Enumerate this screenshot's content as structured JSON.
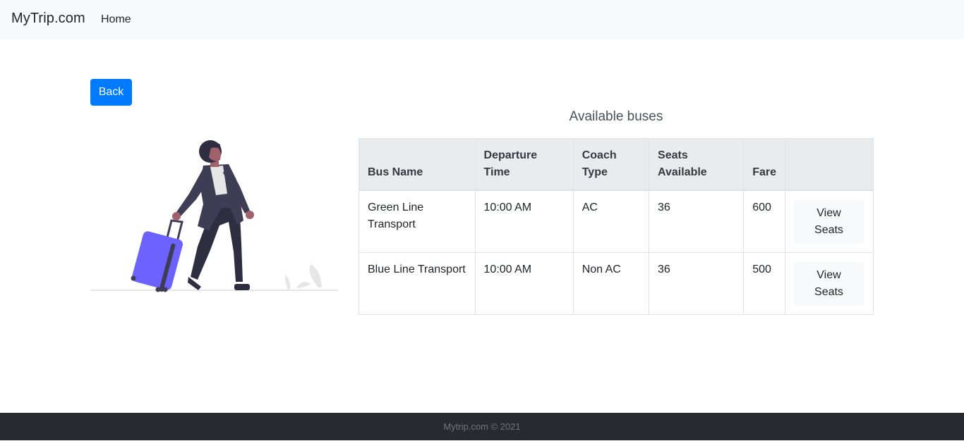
{
  "navbar": {
    "brand": "MyTrip.com",
    "home_label": "Home"
  },
  "back_button": {
    "label": "Back"
  },
  "section_title": "Available buses",
  "table": {
    "headers": {
      "bus_name": "Bus Name",
      "departure_time": "Departure Time",
      "coach_type": "Coach Type",
      "seats_available": "Seats Available",
      "fare": "Fare",
      "action": ""
    },
    "rows": [
      {
        "bus_name": "Green Line Transport",
        "departure_time": "10:00 AM",
        "coach_type": "AC",
        "seats_available": "36",
        "fare": "600",
        "action_label": "View Seats"
      },
      {
        "bus_name": "Blue Line Transport",
        "departure_time": "10:00 AM",
        "coach_type": "Non AC",
        "seats_available": "36",
        "fare": "500",
        "action_label": "View Seats"
      }
    ]
  },
  "illustration": {
    "icon": "traveler-with-suitcase-illustration"
  },
  "colors": {
    "primary": "#007bff",
    "navbar_bg": "#f8f9fa",
    "footer_bg": "#272b30",
    "suitcase": "#6c63ff"
  },
  "footer": {
    "text": "Mytrip.com © 2021"
  }
}
